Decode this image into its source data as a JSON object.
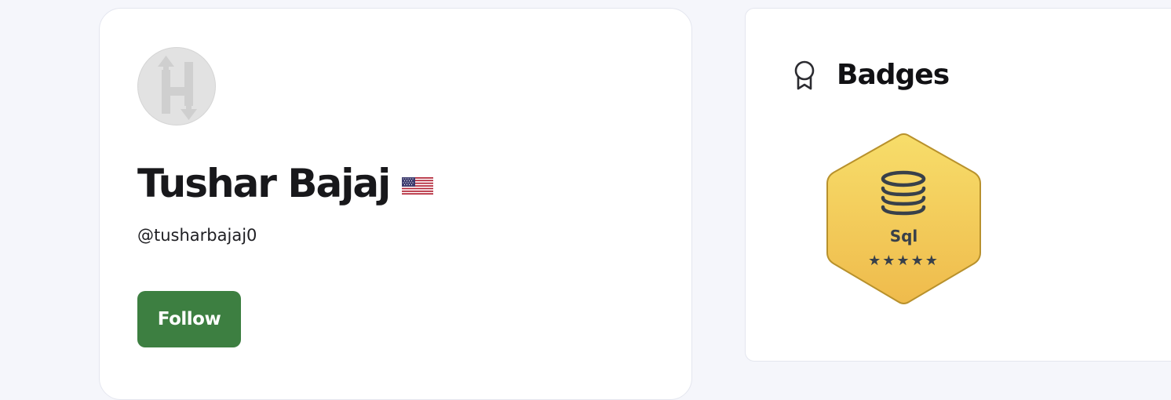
{
  "profile": {
    "name": "Tushar Bajaj",
    "username": "@tusharbajaj0",
    "country_flag": "us-flag-icon",
    "avatar_icon": "hackerrank-h-icon",
    "follow_label": "Follow",
    "follow_color": "#3d7f41"
  },
  "badges": {
    "title": "Badges",
    "header_icon": "award-ribbon-icon",
    "items": [
      {
        "label": "Sql",
        "icon": "database-icon",
        "stars": "★★★★★",
        "star_count": 5,
        "color": "#f2c94c"
      }
    ]
  }
}
